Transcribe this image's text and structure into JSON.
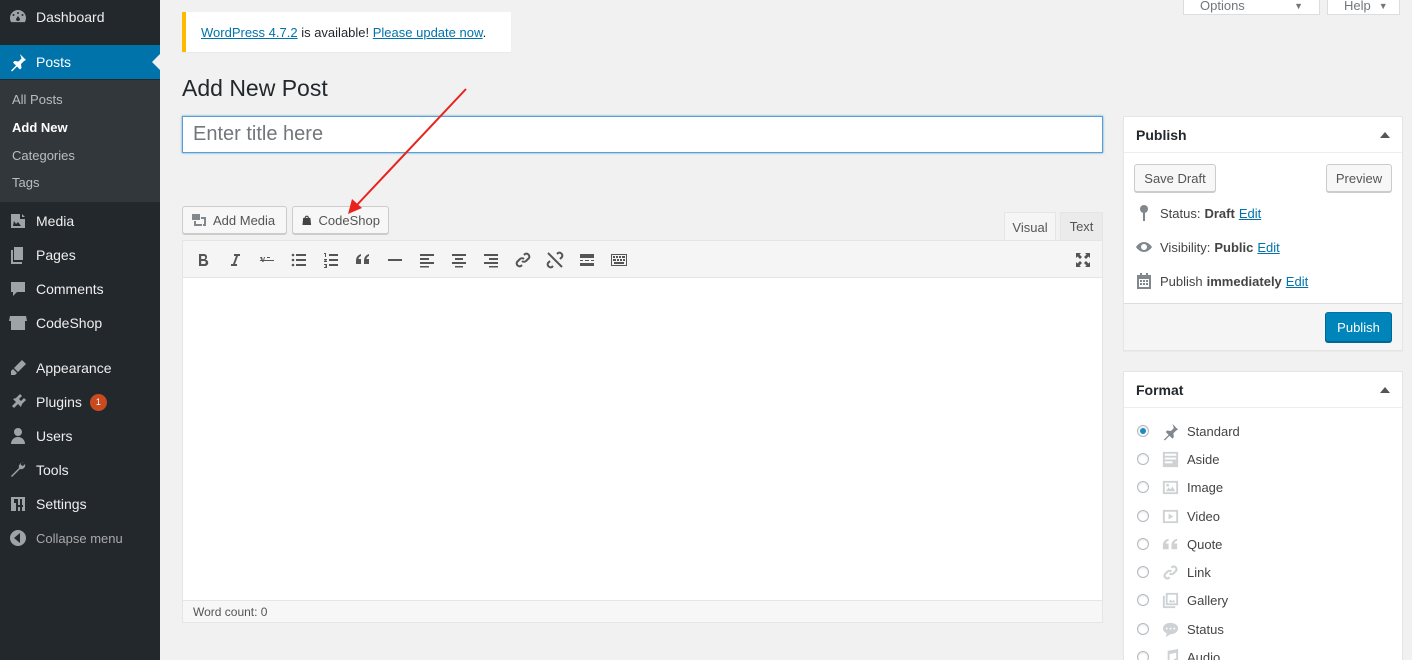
{
  "sidebar": {
    "items": [
      {
        "label": "Dashboard",
        "icon": "dashboard-icon"
      },
      {
        "label": "Posts",
        "icon": "pin-icon"
      },
      {
        "label": "Media",
        "icon": "media-icon"
      },
      {
        "label": "Pages",
        "icon": "pages-icon"
      },
      {
        "label": "Comments",
        "icon": "comments-icon"
      },
      {
        "label": "CodeShop",
        "icon": "shop-icon"
      },
      {
        "label": "Appearance",
        "icon": "brush-icon"
      },
      {
        "label": "Plugins",
        "icon": "plugin-icon",
        "badge": "1"
      },
      {
        "label": "Users",
        "icon": "users-icon"
      },
      {
        "label": "Tools",
        "icon": "wrench-icon"
      },
      {
        "label": "Settings",
        "icon": "settings-icon"
      }
    ],
    "submenu": [
      "All Posts",
      "Add New",
      "Categories",
      "Tags"
    ],
    "collapse_label": "Collapse menu"
  },
  "top": {
    "screen_options": "Screen Options",
    "help": "Help"
  },
  "notice": {
    "version_link": "WordPress 4.7.2",
    "middle_text": " is available! ",
    "update_link": "Please update now",
    "end": "."
  },
  "page": {
    "title": "Add New Post",
    "title_placeholder": "Enter title here"
  },
  "editor": {
    "add_media": "Add Media",
    "codeshop": "CodeShop",
    "tab_visual": "Visual",
    "tab_text": "Text",
    "word_count": "Word count: 0",
    "toolbar": [
      "bold-icon",
      "italic-icon",
      "strikethrough-icon",
      "bullet-list-icon",
      "numbered-list-icon",
      "blockquote-icon",
      "horizontal-line-icon",
      "align-left-icon",
      "align-center-icon",
      "align-right-icon",
      "link-icon",
      "unlink-icon",
      "read-more-icon",
      "toolbar-toggle-icon",
      "fullscreen-icon"
    ]
  },
  "publish": {
    "title": "Publish",
    "save_draft": "Save Draft",
    "preview": "Preview",
    "status_label": "Status:",
    "status_value": "Draft",
    "visibility_label": "Visibility:",
    "visibility_value": "Public",
    "publish_label": "Publish",
    "publish_value": "immediately",
    "edit": "Edit",
    "publish_button": "Publish"
  },
  "format": {
    "title": "Format",
    "selected": "Standard",
    "options": [
      "Standard",
      "Aside",
      "Image",
      "Video",
      "Quote",
      "Link",
      "Gallery",
      "Status",
      "Audio"
    ]
  },
  "colors": {
    "sidebar_bg": "#23282d",
    "accent": "#0073aa",
    "notice_border": "#ffb900",
    "arrow": "#e8221d"
  }
}
